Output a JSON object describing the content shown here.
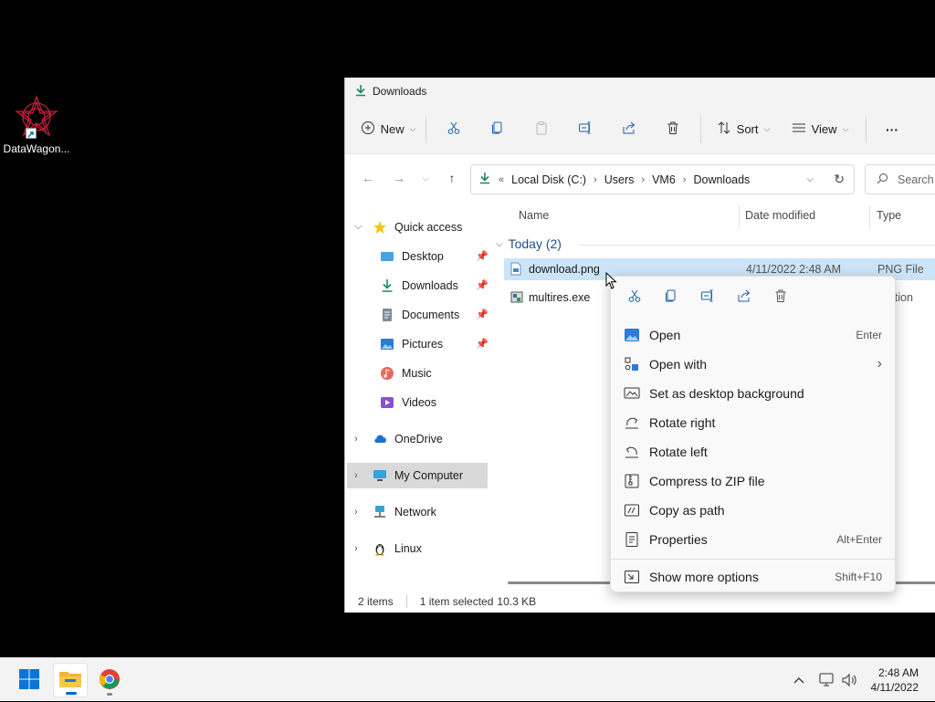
{
  "desktop": {
    "icon_label": "DataWagon..."
  },
  "window": {
    "title": "Downloads",
    "toolbar": {
      "new_label": "New",
      "sort_label": "Sort",
      "view_label": "View",
      "more_label": "···"
    },
    "address": {
      "overflow": "«",
      "crumbs": [
        "Local Disk (C:)",
        "Users",
        "VM6",
        "Downloads"
      ]
    },
    "search_placeholder": "Search",
    "sidebar": {
      "quick_access": "Quick access",
      "items": [
        "Desktop",
        "Downloads",
        "Documents",
        "Pictures",
        "Music",
        "Videos"
      ],
      "onedrive": "OneDrive",
      "my_computer": "My Computer",
      "network": "Network",
      "linux": "Linux"
    },
    "columns": {
      "name": "Name",
      "date": "Date modified",
      "type": "Type"
    },
    "group": "Today (2)",
    "files": [
      {
        "name": "download.png",
        "date": "4/11/2022 2:48 AM",
        "type": "PNG File"
      },
      {
        "name": "multires.exe",
        "date": "",
        "type": "lication"
      }
    ],
    "status": {
      "count": "2 items",
      "selected": "1 item selected",
      "size": "10.3 KB"
    }
  },
  "context_menu": {
    "items": [
      {
        "label": "Open",
        "shortcut": "Enter"
      },
      {
        "label": "Open with",
        "shortcut": "›"
      },
      {
        "label": "Set as desktop background",
        "shortcut": ""
      },
      {
        "label": "Rotate right",
        "shortcut": ""
      },
      {
        "label": "Rotate left",
        "shortcut": ""
      },
      {
        "label": "Compress to ZIP file",
        "shortcut": ""
      },
      {
        "label": "Copy as path",
        "shortcut": ""
      },
      {
        "label": "Properties",
        "shortcut": "Alt+Enter"
      },
      {
        "label": "Show more options",
        "shortcut": "Shift+F10"
      }
    ]
  },
  "taskbar": {
    "time": "2:48 AM",
    "date": "4/11/2022"
  },
  "colors": {
    "accent": "#0067c0",
    "selection": "#cce4f7",
    "folder": "#f8c74a"
  }
}
